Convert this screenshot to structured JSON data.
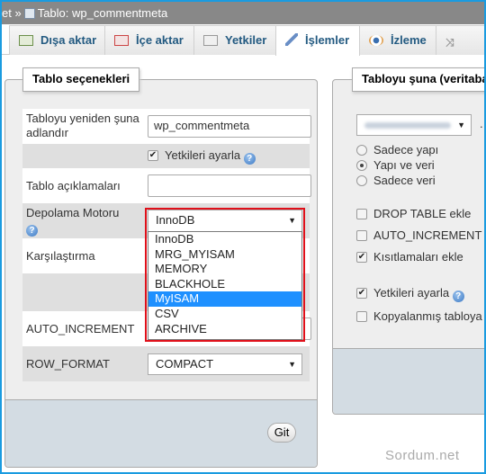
{
  "topbar": {
    "breadcrumb_prefix": "et »",
    "title": "Tablo: wp_commentmeta"
  },
  "tabs": [
    {
      "label": "Dışa aktar",
      "icon": "export-icon"
    },
    {
      "label": "İçe aktar",
      "icon": "import-icon"
    },
    {
      "label": "Yetkiler",
      "icon": "privileges-icon"
    },
    {
      "label": "İşlemler",
      "icon": "wrench-icon",
      "active": true
    },
    {
      "label": "İzleme",
      "icon": "eye-icon"
    },
    {
      "label": "",
      "icon": "triggers-icon"
    }
  ],
  "left": {
    "legend": "Tablo seçenekleri",
    "rename_label": "Tabloyu yeniden şuna adlandır",
    "rename_value": "wp_commentmeta",
    "adjust_privileges": {
      "label": "Yetkileri ayarla",
      "checked": true
    },
    "comments_label": "Tablo açıklamaları",
    "comments_value": "",
    "engine_label": "Depolama Motoru",
    "engine_selected": "InnoDB",
    "engine_options": [
      "InnoDB",
      "MRG_MYISAM",
      "MEMORY",
      "BLACKHOLE",
      "MyISAM",
      "CSV",
      "ARCHIVE"
    ],
    "engine_highlighted": "MyISAM",
    "collation_label": "Karşılaştırma",
    "auto_increment_label": "AUTO_INCREMENT",
    "row_format_label": "ROW_FORMAT",
    "row_format_value": "COMPACT",
    "go_button": "Git"
  },
  "right": {
    "legend": "Tabloyu şuna (veritaba",
    "db_separator": ".",
    "radios": [
      {
        "label": "Sadece yapı",
        "checked": false
      },
      {
        "label": "Yapı ve veri",
        "checked": true
      },
      {
        "label": "Sadece veri",
        "checked": false
      }
    ],
    "checkboxes": [
      {
        "label": "DROP TABLE ekle",
        "checked": false
      },
      {
        "label": "AUTO_INCREMENT",
        "checked": false
      },
      {
        "label": "Kısıtlamaları ekle",
        "checked": true
      },
      {
        "label": "Yetkileri ayarla",
        "checked": true
      },
      {
        "label": "Kopyalanmış tabloya",
        "checked": false
      }
    ]
  },
  "watermark": "Sordum.net",
  "colors": {
    "tab_text": "#235a81",
    "highlight": "#1e90ff",
    "red_outline": "#e0101a",
    "frame": "#1a9be0"
  }
}
